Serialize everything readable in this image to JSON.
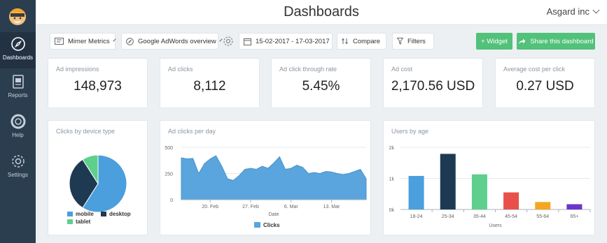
{
  "sidebar": {
    "items": [
      {
        "label": "Dashboards",
        "icon": "compass-icon",
        "active": true
      },
      {
        "label": "Reports",
        "icon": "report-icon"
      },
      {
        "label": "Help",
        "icon": "lifebuoy-icon"
      },
      {
        "label": "Settings",
        "icon": "gear-icon"
      }
    ]
  },
  "header": {
    "title": "Dashboards",
    "organization": "Asgard inc"
  },
  "toolbar": {
    "account": "Mimer Metrics",
    "dashboard": "Google AdWords overview",
    "date_range": "15-02-2017 - 17-03-2017",
    "compare": "Compare",
    "filters": "Filters",
    "add_widget": "+ Widget",
    "share": "Share this dashboard"
  },
  "kpis": [
    {
      "label": "Ad impressions",
      "value": "148,973"
    },
    {
      "label": "Ad clicks",
      "value": "8,112"
    },
    {
      "label": "Ad click through rate",
      "value": "5.45%"
    },
    {
      "label": "Ad cost",
      "value": "2,170.56 USD"
    },
    {
      "label": "Average cost per click",
      "value": "0.27 USD"
    }
  ],
  "colors": {
    "accent_green": "#52c17a",
    "sidebar": "#2b3e50",
    "blue": "#4a9fdc",
    "area_blue": "#5aa5dd"
  },
  "chart_data": [
    {
      "type": "pie",
      "title": "Clicks by device type",
      "categories": [
        "mobile",
        "desktop",
        "tablet"
      ],
      "values": [
        59,
        32,
        9
      ],
      "colors": [
        "#4a9fdc",
        "#1e3a52",
        "#5ecf8c"
      ]
    },
    {
      "type": "area",
      "title": "Ad clicks per day",
      "xlabel": "Date",
      "ylim": [
        0,
        500
      ],
      "yticks": [
        "0",
        "250",
        "500"
      ],
      "y_tick_values": [
        0,
        250,
        500
      ],
      "xticks": [
        "20. Feb",
        "27. Feb",
        "6. Mar",
        "13. Mar"
      ],
      "x_tick_days": [
        5,
        12,
        19,
        26
      ],
      "legend": "Clicks",
      "series": [
        {
          "name": "Clicks",
          "values": [
            400,
            390,
            395,
            250,
            345,
            390,
            420,
            320,
            200,
            185,
            230,
            290,
            300,
            290,
            320,
            300,
            350,
            410,
            290,
            300,
            330,
            310,
            250,
            260,
            250,
            270,
            265,
            250,
            240,
            250,
            270,
            290,
            200
          ]
        }
      ]
    },
    {
      "type": "bar",
      "title": "Users by age",
      "xlabel": "Users",
      "categories": [
        "18-24",
        "25-34",
        "35-44",
        "45-54",
        "55-64",
        "65+"
      ],
      "values": [
        1080,
        1790,
        1130,
        550,
        240,
        170
      ],
      "ylim": [
        0,
        2000
      ],
      "yticks": [
        "0k",
        "1k",
        "2k"
      ],
      "y_tick_values": [
        0,
        1000,
        2000
      ],
      "colors": [
        "#4a9fdc",
        "#1e3a52",
        "#5ecf8c",
        "#e8514a",
        "#f5a623",
        "#6b35c9"
      ]
    }
  ]
}
